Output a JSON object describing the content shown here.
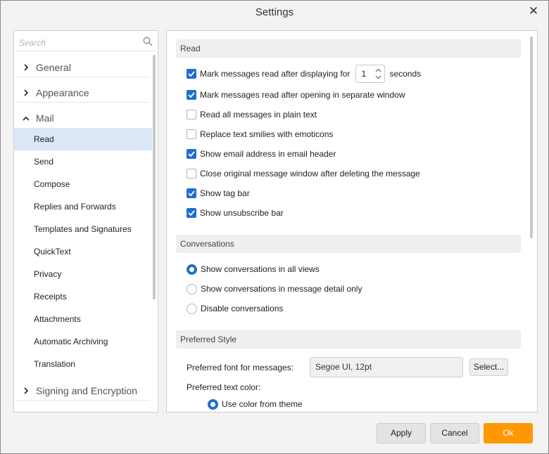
{
  "window": {
    "title": "Settings",
    "close_glyph": "✕"
  },
  "sidebar": {
    "search_placeholder": "Search",
    "groups": [
      {
        "label": "General",
        "expanded": false
      },
      {
        "label": "Appearance",
        "expanded": false
      },
      {
        "label": "Mail",
        "expanded": true
      },
      {
        "label": "Signing and Encryption",
        "expanded": false
      }
    ],
    "mail_items": [
      "Read",
      "Send",
      "Compose",
      "Replies and Forwards",
      "Templates and Signatures",
      "QuickText",
      "Privacy",
      "Receipts",
      "Attachments",
      "Automatic Archiving",
      "Translation"
    ],
    "active_item": "Read"
  },
  "read": {
    "header": "Read",
    "mark_read_after_display": {
      "label": "Mark messages read after displaying for",
      "checked": true,
      "seconds_value": "1",
      "suffix": "seconds"
    },
    "mark_read_separate_window": {
      "label": "Mark messages read after opening in separate window",
      "checked": true
    },
    "plain_text": {
      "label": "Read all messages in plain text",
      "checked": false
    },
    "replace_smilies": {
      "label": "Replace text smilies with emoticons",
      "checked": false
    },
    "show_email_address": {
      "label": "Show email address in email header",
      "checked": true
    },
    "close_original": {
      "label": "Close original message window after deleting the message",
      "checked": false
    },
    "show_tag_bar": {
      "label": "Show tag bar",
      "checked": true
    },
    "show_unsubscribe_bar": {
      "label": "Show unsubscribe bar",
      "checked": true
    }
  },
  "conversations": {
    "header": "Conversations",
    "options": [
      {
        "label": "Show conversations in all views",
        "selected": true
      },
      {
        "label": "Show conversations in message detail only",
        "selected": false
      },
      {
        "label": "Disable conversations",
        "selected": false
      }
    ]
  },
  "preferred_style": {
    "header": "Preferred Style",
    "font_label": "Preferred font for messages:",
    "font_value": "Segoe UI, 12pt",
    "select_label": "Select...",
    "text_color_label": "Preferred text color:",
    "use_theme_color": {
      "label": "Use color from theme",
      "selected": true
    }
  },
  "footer": {
    "apply": "Apply",
    "cancel": "Cancel",
    "ok": "Ok"
  },
  "colors": {
    "accent": "#1f6fd1",
    "ok_button": "#ff9800",
    "active_nav": "#dce8f7"
  }
}
